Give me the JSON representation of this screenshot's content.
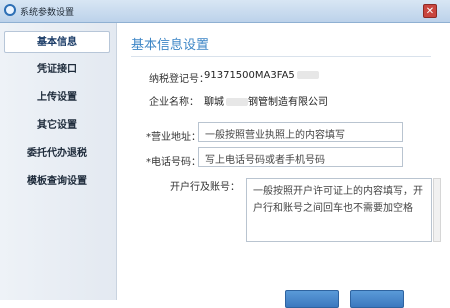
{
  "window": {
    "title": "系统参数设置",
    "close_glyph": "✕"
  },
  "sidebar": {
    "items": [
      {
        "label": "基本信息"
      },
      {
        "label": "凭证接口"
      },
      {
        "label": "上传设置"
      },
      {
        "label": "其它设置"
      },
      {
        "label": "委托代办退税"
      },
      {
        "label": "模板查询设置"
      }
    ]
  },
  "main": {
    "section_title": "基本信息设置",
    "tax_id": {
      "label": "纳税登记号：",
      "value": "91371500MA3FA5"
    },
    "company": {
      "label": "企业名称：",
      "value_left": "聊城",
      "value_right": "钢管制造有限公司"
    },
    "address": {
      "label": "*营业地址：",
      "placeholder": "一般按照营业执照上的内容填写"
    },
    "phone": {
      "label": "*电话号码：",
      "placeholder": "写上电话号码或者手机号码"
    },
    "bank": {
      "label": "开户行及账号：",
      "text": "一般按照开户许可证上的内容填写，开户行和账号之间回车也不需要加空格"
    }
  },
  "buttons": {
    "primary": "",
    "secondary": ""
  }
}
